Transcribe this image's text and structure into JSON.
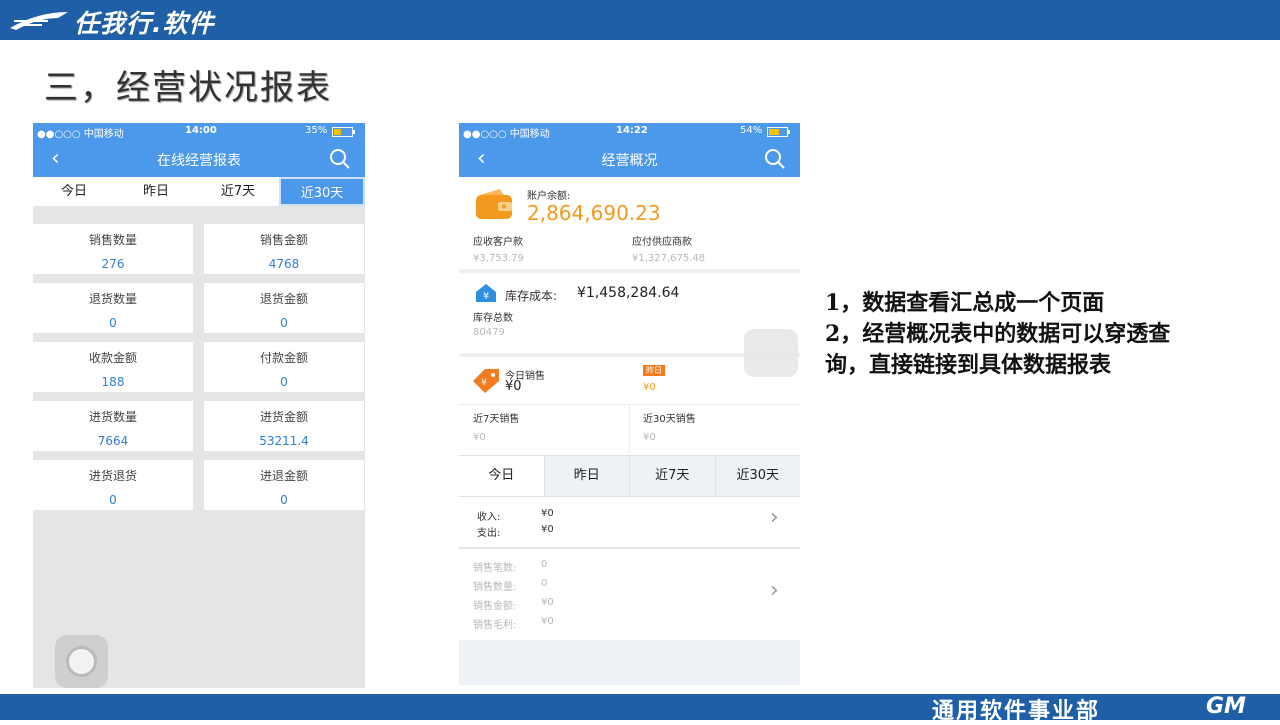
{
  "header": {
    "brand": "任我行.软件"
  },
  "slide": {
    "title": "三，经营状况报表"
  },
  "footer": {
    "dept": "通用软件事业部",
    "logo": "GM"
  },
  "phone1": {
    "status": {
      "carrier": "●●○○○ 中国移动",
      "time": "14:00",
      "battery": "35%"
    },
    "title": "在线经营报表",
    "tabs": [
      "今日",
      "昨日",
      "近7天",
      "近30天"
    ],
    "cells": [
      {
        "label": "销售数量",
        "value": "276"
      },
      {
        "label": "销售金额",
        "value": "4768"
      },
      {
        "label": "退货数量",
        "value": "0"
      },
      {
        "label": "退货金额",
        "value": "0"
      },
      {
        "label": "收款金额",
        "value": "188"
      },
      {
        "label": "付款金额",
        "value": "0"
      },
      {
        "label": "进货数量",
        "value": "7664"
      },
      {
        "label": "进货金额",
        "value": "53211.4"
      },
      {
        "label": "进货退货",
        "value": "0"
      },
      {
        "label": "进退金额",
        "value": "0"
      }
    ]
  },
  "phone2": {
    "status": {
      "carrier": "●●○○○ 中国移动",
      "time": "14:22",
      "battery": "54%"
    },
    "title": "经营概况",
    "balance_label": "账户余额:",
    "balance_value": "2,864,690.23",
    "receivable_label": "应收客户款",
    "receivable_value": "¥3,753.79",
    "payable_label": "应付供应商款",
    "payable_value": "¥1,327,675.48",
    "stock_cost_label": "库存成本:",
    "stock_cost_value": "¥1,458,284.64",
    "stock_total_label": "库存总数",
    "stock_total_value": "80479",
    "today_sales_label": "今日销售",
    "today_sales_value": "¥0",
    "yesterday_badge": "昨日",
    "yesterday_value": "¥0",
    "week_label": "近7天销售",
    "week_value": "¥0",
    "month_label": "近30天销售",
    "month_value": "¥0",
    "tabs": [
      "今日",
      "昨日",
      "近7天",
      "近30天"
    ],
    "income_label": "收入:",
    "income_value": "¥0",
    "expense_label": "支出:",
    "expense_value": "¥0",
    "stats": [
      {
        "label": "销售笔数:",
        "value": "0"
      },
      {
        "label": "销售数量:",
        "value": "0"
      },
      {
        "label": "销售金额:",
        "value": "¥0"
      },
      {
        "label": "销售毛利:",
        "value": "¥0"
      }
    ]
  },
  "notes": {
    "line1": "1，数据查看汇总成一个页面",
    "line2": "2，经营概况表中的数据可以穿透查",
    "line3": "询，直接链接到具体数据报表"
  },
  "colors": {
    "brand_blue": "#1f5fa8",
    "app_blue": "#4c98ea",
    "accent_orange": "#f39a1e"
  }
}
